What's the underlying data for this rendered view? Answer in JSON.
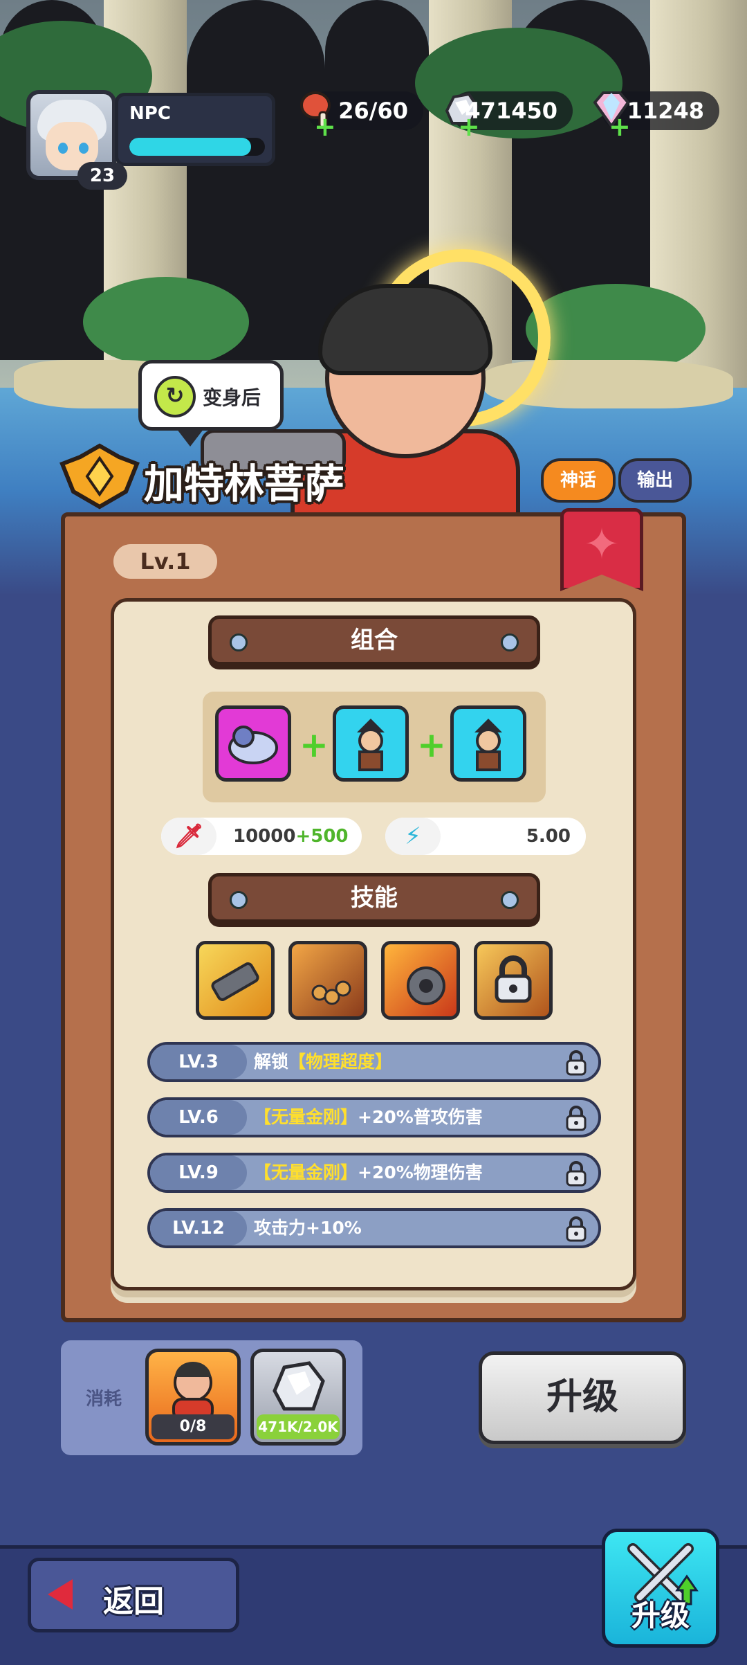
{
  "player": {
    "name": "NPC",
    "level": "23",
    "exp_fraction": 0.9
  },
  "resources": {
    "stamina": {
      "value": "26/60",
      "icon": "meat-icon"
    },
    "silver": {
      "value": "471450",
      "icon": "silver-ore-icon"
    },
    "gems": {
      "value": "11248",
      "icon": "diamond-icon"
    }
  },
  "transform_bubble": {
    "label": "变身后",
    "icon": "swap-icon"
  },
  "hero": {
    "name": "加特林菩萨",
    "tags": [
      "神话",
      "输出"
    ]
  },
  "card": {
    "level": "Lv.1",
    "combo_title": "组合",
    "combo_units": [
      {
        "icon": "wolf-knight-icon",
        "rarity_color": "#e23ad6"
      },
      {
        "icon": "bandit-icon",
        "rarity_color": "#33d3ee"
      },
      {
        "icon": "bandit-icon",
        "rarity_color": "#33d3ee"
      }
    ],
    "attack": {
      "base": "10000",
      "bonus": "+500",
      "icon": "sword-icon"
    },
    "attack_speed": {
      "value": "5.00",
      "icon": "lightning-boot-icon"
    },
    "skills_title": "技能",
    "skills": [
      {
        "icon": "gatling-icon",
        "locked": false
      },
      {
        "icon": "prayer-beads-icon",
        "locked": false
      },
      {
        "icon": "fire-barrel-icon",
        "locked": false
      },
      {
        "icon": "golden-skill-icon",
        "locked": true
      }
    ],
    "unlocks": [
      {
        "level": "LV.3",
        "pre": "解锁",
        "highlight": "【物理超度】",
        "post": ""
      },
      {
        "level": "LV.6",
        "pre": "",
        "highlight": "【无量金刚】",
        "post": "+20%普攻伤害"
      },
      {
        "level": "LV.9",
        "pre": "",
        "highlight": "【无量金刚】",
        "post": "+20%物理伤害"
      },
      {
        "level": "LV.12",
        "pre": "攻击力+10%",
        "highlight": "",
        "post": ""
      }
    ]
  },
  "cost": {
    "label": "消耗",
    "items": [
      {
        "icon": "hero-shard-icon",
        "count": "0/8"
      },
      {
        "icon": "silver-ore-icon",
        "count": "471K/2.0K"
      }
    ]
  },
  "upgrade_button": "升级",
  "back_button": "返回",
  "nav_upgrade": "升级"
}
